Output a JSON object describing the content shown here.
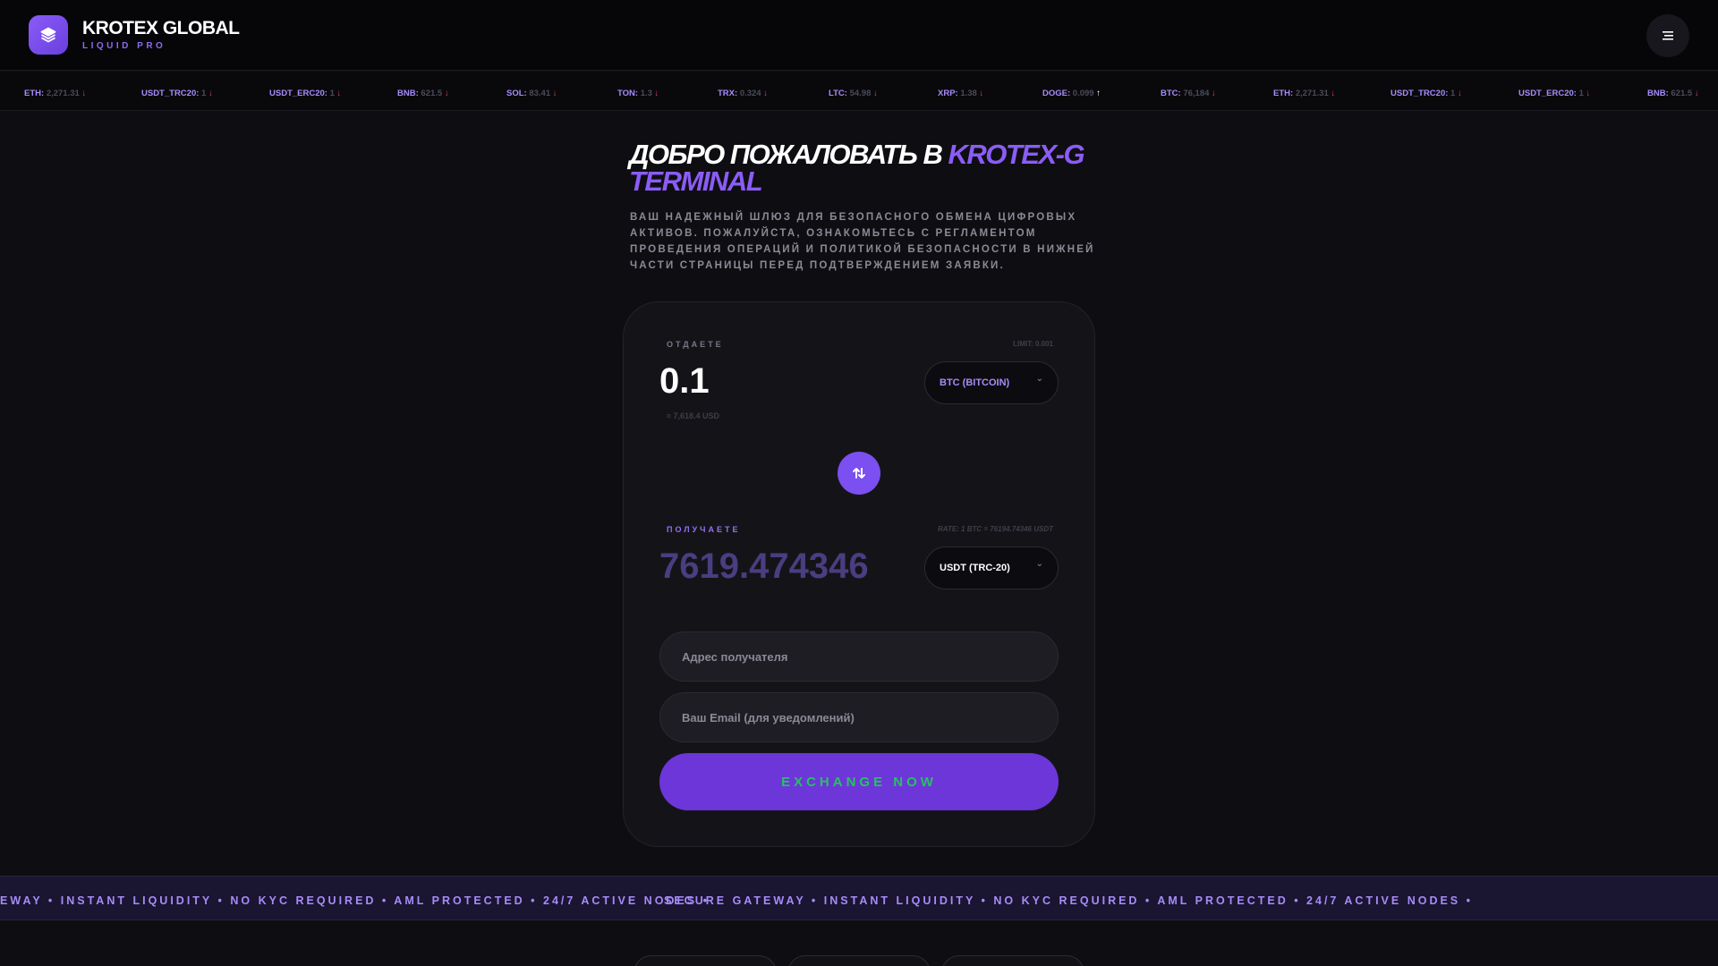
{
  "header": {
    "brand_title": "KROTEX GLOBAL",
    "brand_subtitle": "LIQUID PRO",
    "logo_icon": "layers-icon",
    "menu_icon": "menu-icon",
    "accent": "#8b5cf6"
  },
  "ticker": [
    {
      "symbol": "ETH:",
      "value": "2,271.31",
      "dir": "down"
    },
    {
      "symbol": "USDT_TRC20:",
      "value": "1",
      "dir": "down"
    },
    {
      "symbol": "USDT_ERC20:",
      "value": "1",
      "dir": "down"
    },
    {
      "symbol": "BNB:",
      "value": "621.5",
      "dir": "down"
    },
    {
      "symbol": "SOL:",
      "value": "83.41",
      "dir": "down"
    },
    {
      "symbol": "TON:",
      "value": "1.3",
      "dir": "down"
    },
    {
      "symbol": "TRX:",
      "value": "0.324",
      "dir": "down"
    },
    {
      "symbol": "LTC:",
      "value": "54.98",
      "dir": "down"
    },
    {
      "symbol": "XRP:",
      "value": "1.38",
      "dir": "down"
    },
    {
      "symbol": "DOGE:",
      "value": "0.099",
      "dir": "up"
    },
    {
      "symbol": "BTC:",
      "value": "76,184",
      "dir": "down"
    },
    {
      "symbol": "ETH:",
      "value": "2,271.31",
      "dir": "down"
    },
    {
      "symbol": "USDT_TRC20:",
      "value": "1",
      "dir": "down"
    },
    {
      "symbol": "USDT_ERC20:",
      "value": "1",
      "dir": "down"
    },
    {
      "symbol": "BNB:",
      "value": "621.5",
      "dir": "down"
    }
  ],
  "hero": {
    "title_main": "ДОБРО ПОЖАЛОВАТЬ В ",
    "title_accent_1": "KROTEX-G",
    "title_accent_2": "TERMINAL",
    "description": "ВАШ НАДЕЖНЫЙ ШЛЮЗ ДЛЯ БЕЗОПАСНОГО ОБМЕНА ЦИФРОВЫХ АКТИВОВ. ПОЖАЛУЙСТА, ОЗНАКОМЬТЕСЬ С РЕГЛАМЕНТОМ ПРОВЕДЕНИЯ ОПЕРАЦИЙ И ПОЛИТИКОЙ БЕЗОПАСНОСТИ В НИЖНЕЙ ЧАСТИ СТРАНИЦЫ ПЕРЕД ПОДТВЕРЖДЕНИЕМ ЗАЯВКИ."
  },
  "exchange": {
    "give_label": "ОТДАЕТЕ",
    "limit": "LIMIT: 0.001",
    "give_amount": "0.1",
    "give_usd": "≈ 7,618.4 USD",
    "give_currency": "BTC (BITCOIN)",
    "swap_icon": "swap-arrows-icon",
    "receive_label": "ПОЛУЧАЕТЕ",
    "rate": "RATE: 1 BTC = 76194.74346 USDT",
    "receive_amount": "7619.474346",
    "receive_currency": "USDT (TRC-20)",
    "address_placeholder": "Адрес получателя",
    "email_placeholder": "Ваш Email (для уведомлений)",
    "submit_label": "EXCHANGE NOW"
  },
  "marquee": {
    "text_1": "EWAY • INSTANT LIQUIDITY • NO KYC REQUIRED • AML PROTECTED • 24/7 ACTIVE NODES •",
    "text_2": "SECURE GATEWAY • INSTANT LIQUIDITY • NO KYC REQUIRED • AML PROTECTED • 24/7 ACTIVE NODES •"
  }
}
